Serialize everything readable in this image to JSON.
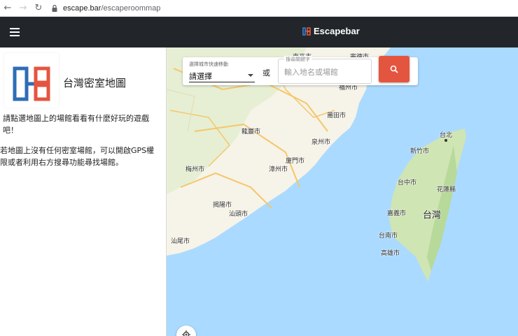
{
  "browser": {
    "url_host": "escape.bar",
    "url_path": "/escaperoommap",
    "icons": [
      "back-arrow-icon",
      "forward-arrow-icon",
      "reload-icon",
      "lock-icon"
    ]
  },
  "header": {
    "brand_name": "Escapebar",
    "menu_icon": "hamburger-icon",
    "bg_color": "#22262a"
  },
  "sidebar": {
    "title": "台灣密室地圖",
    "paragraph1": "請點選地圖上的場館看看有什麼好玩的遊戲吧！",
    "paragraph2": "若地圖上沒有任何密室場館，可以開啟GPS權限或者利用右方搜尋功能尋找場館。"
  },
  "search": {
    "city_label": "選擇城市快速移動",
    "city_value": "請選擇",
    "or_text": "或",
    "keyword_label": "搜尋關鍵字",
    "keyword_placeholder": "輸入地名或場館",
    "keyword_value": "",
    "button_icon": "search-icon",
    "button_color": "#e4553f"
  },
  "map": {
    "labels": {
      "nanping": "南平市",
      "ningde": "寧德市",
      "fuzhou": "福州市",
      "putian": "莆田市",
      "longyan": "龍巖市",
      "quanzhou": "泉州市",
      "meizhou": "梅州市",
      "xiamen": "廈門市",
      "zhangzhou": "漳州市",
      "jieyang": "揭陽市",
      "shantou": "汕頭市",
      "shanwei": "汕尾市",
      "taipei": "台北",
      "hsinchu": "新竹市",
      "taichung": "台中市",
      "hualien": "花蓮縣",
      "chiayi": "嘉義市",
      "taiwan": "台灣",
      "tainan": "台南市",
      "kaohsiung": "高雄市"
    },
    "locate_icon": "my-location-icon"
  }
}
